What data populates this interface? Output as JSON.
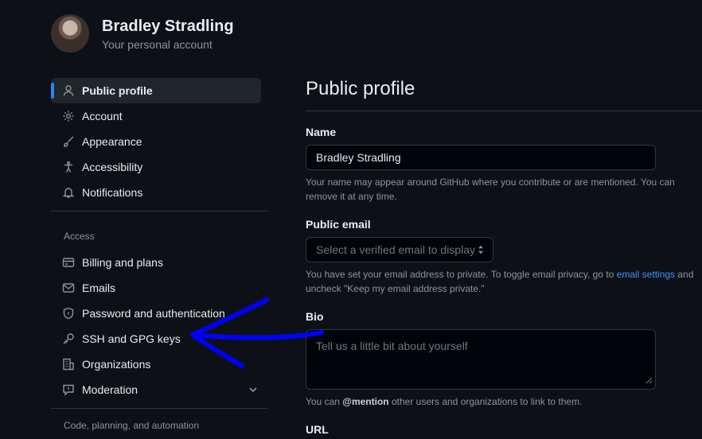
{
  "header": {
    "name": "Bradley Stradling",
    "subtitle": "Your personal account"
  },
  "sidebar": {
    "items": [
      {
        "label": "Public profile",
        "icon": "person-icon"
      },
      {
        "label": "Account",
        "icon": "gear-icon"
      },
      {
        "label": "Appearance",
        "icon": "paintbrush-icon"
      },
      {
        "label": "Accessibility",
        "icon": "accessibility-icon"
      },
      {
        "label": "Notifications",
        "icon": "bell-icon"
      }
    ],
    "access_heading": "Access",
    "access_items": [
      {
        "label": "Billing and plans",
        "icon": "credit-card-icon"
      },
      {
        "label": "Emails",
        "icon": "mail-icon"
      },
      {
        "label": "Password and authentication",
        "icon": "shield-lock-icon"
      },
      {
        "label": "SSH and GPG keys",
        "icon": "key-icon"
      },
      {
        "label": "Organizations",
        "icon": "organization-icon"
      },
      {
        "label": "Moderation",
        "icon": "report-icon"
      }
    ],
    "code_heading": "Code, planning, and automation"
  },
  "main": {
    "title": "Public profile",
    "name_label": "Name",
    "name_value": "Bradley Stradling",
    "name_help": "Your name may appear around GitHub where you contribute or are mentioned. You can remove it at any time.",
    "email_label": "Public email",
    "email_placeholder": "Select a verified email to display",
    "email_help_pre": "You have set your email address to private. To toggle email privacy, go to ",
    "email_help_link": "email settings",
    "email_help_post": " and uncheck \"Keep my email address private.\"",
    "bio_label": "Bio",
    "bio_placeholder": "Tell us a little bit about yourself",
    "bio_help_pre": "You can ",
    "bio_help_mention": "@mention",
    "bio_help_post": " other users and organizations to link to them.",
    "url_label": "URL"
  },
  "annotation": {
    "color": "#0000ff",
    "icon": "hand-drawn-arrow"
  }
}
